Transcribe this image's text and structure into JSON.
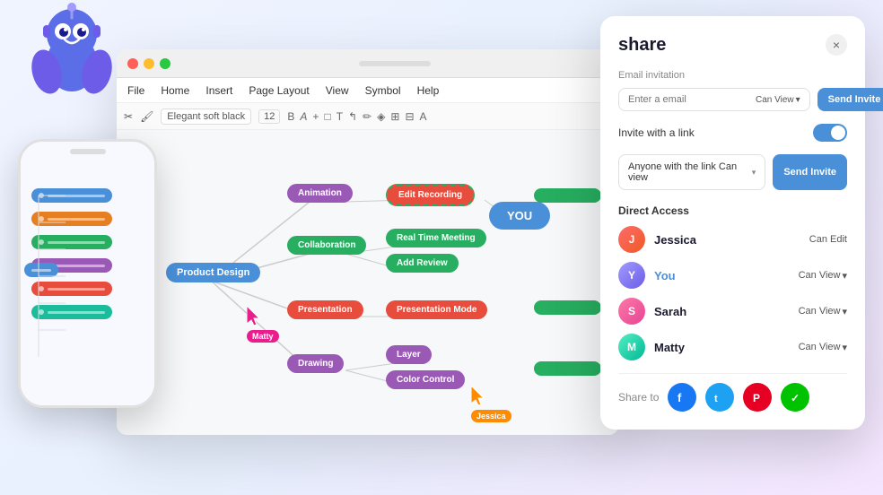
{
  "mascot": {
    "alt": "Robot mascot"
  },
  "desktop": {
    "titlebar": {
      "dot_colors": [
        "#ff5f57",
        "#febc2e",
        "#28c840"
      ]
    },
    "menubar": {
      "items": [
        "File",
        "Home",
        "Insert",
        "Page Layout",
        "View",
        "Symbol",
        "Help"
      ]
    },
    "toolbar": {
      "font_name": "Elegant soft black",
      "font_size": "12"
    },
    "canvas": {
      "nodes": [
        {
          "id": "product-design",
          "label": "Product Design",
          "color": "blue"
        },
        {
          "id": "animation",
          "label": "Animation",
          "color": "purple"
        },
        {
          "id": "edit-recording",
          "label": "Edit Recording",
          "color": "red"
        },
        {
          "id": "collaboration",
          "label": "Collaboration",
          "color": "green"
        },
        {
          "id": "real-time-meeting",
          "label": "Real Time Meeting",
          "color": "green"
        },
        {
          "id": "add-review",
          "label": "Add Review",
          "color": "green"
        },
        {
          "id": "presentation",
          "label": "Presentation",
          "color": "red"
        },
        {
          "id": "presentation-mode",
          "label": "Presentation Mode",
          "color": "red"
        },
        {
          "id": "drawing",
          "label": "Drawing",
          "color": "purple"
        },
        {
          "id": "layer",
          "label": "Layer",
          "color": "purple"
        },
        {
          "id": "color-control",
          "label": "Color Control",
          "color": "purple"
        },
        {
          "id": "you-badge",
          "label": "YOU",
          "color": "blue"
        }
      ],
      "cursors": [
        {
          "name": "Matty",
          "color": "#e91e8c"
        },
        {
          "name": "Jessica",
          "color": "#ff8c00"
        }
      ]
    }
  },
  "share_panel": {
    "title": "share",
    "close_label": "×",
    "email_section": {
      "label": "Email invitation",
      "placeholder": "Enter a email",
      "permission": "Can View",
      "button_label": "Send Invite"
    },
    "link_section": {
      "label": "Invite with a link",
      "dropdown_text": "Anyone with the link Can view",
      "button_label": "Send Invite"
    },
    "direct_access": {
      "label": "Direct Access",
      "users": [
        {
          "name": "Jessica",
          "permission": "Can Edit",
          "has_dropdown": false,
          "avatar_initials": "J",
          "avatar_class": "av-jessica"
        },
        {
          "name": "You",
          "permission": "Can View",
          "has_dropdown": true,
          "avatar_initials": "Y",
          "avatar_class": "av-you"
        },
        {
          "name": "Sarah",
          "permission": "Can View",
          "has_dropdown": true,
          "avatar_initials": "S",
          "avatar_class": "av-sarah"
        },
        {
          "name": "Matty",
          "permission": "Can View",
          "has_dropdown": true,
          "avatar_initials": "M",
          "avatar_class": "av-matty"
        }
      ]
    },
    "share_to": {
      "label": "Share to",
      "platforms": [
        {
          "name": "Facebook",
          "symbol": "f",
          "class": "social-fb"
        },
        {
          "name": "Twitter",
          "symbol": "t",
          "class": "social-tw"
        },
        {
          "name": "Pinterest",
          "symbol": "P",
          "class": "social-pt"
        },
        {
          "name": "Line",
          "symbol": "✓",
          "class": "social-ln"
        }
      ]
    }
  },
  "mobile": {
    "nodes_left": [
      {
        "color": "#4a90d9"
      },
      {
        "color": "#e67e22"
      },
      {
        "color": "#27ae60"
      },
      {
        "color": "#9b59b6"
      },
      {
        "color": "#e74c3c"
      },
      {
        "color": "#1abc9c"
      }
    ],
    "nodes_right": [
      {
        "color": "#4a90d9"
      },
      {
        "color": "#9b59b6"
      },
      {
        "color": "#e74c3c"
      }
    ]
  }
}
